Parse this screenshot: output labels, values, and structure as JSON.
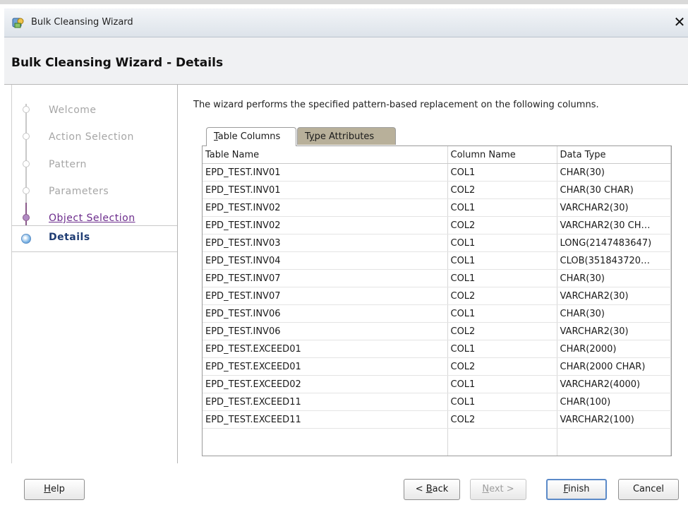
{
  "window": {
    "title": "Bulk Cleansing Wizard",
    "close_glyph": "✕"
  },
  "header": {
    "title": "Bulk Cleansing Wizard - Details"
  },
  "nav": {
    "items": [
      {
        "label": "Welcome",
        "state": "disabled"
      },
      {
        "label": "Action Selection",
        "state": "disabled"
      },
      {
        "label": "Pattern",
        "state": "disabled"
      },
      {
        "label": "Parameters",
        "state": "disabled"
      },
      {
        "label": "Object Selection",
        "state": "visited"
      },
      {
        "label": "Details",
        "state": "current"
      }
    ]
  },
  "main": {
    "description": "The wizard performs the specified pattern-based replacement on the following columns.",
    "tabs": [
      {
        "label": "Table Columns",
        "mnemonic_index": 0,
        "selected": true
      },
      {
        "label": "Type Attributes",
        "mnemonic_index": 1,
        "selected": false
      }
    ],
    "table": {
      "columns": [
        "Table Name",
        "Column Name",
        "Data Type"
      ],
      "rows": [
        [
          "EPD_TEST.INV01",
          "COL1",
          "CHAR(30)"
        ],
        [
          "EPD_TEST.INV01",
          "COL2",
          "CHAR(30 CHAR)"
        ],
        [
          "EPD_TEST.INV02",
          "COL1",
          "VARCHAR2(30)"
        ],
        [
          "EPD_TEST.INV02",
          "COL2",
          "VARCHAR2(30 CH…"
        ],
        [
          "EPD_TEST.INV03",
          "COL1",
          "LONG(2147483647)"
        ],
        [
          "EPD_TEST.INV04",
          "COL1",
          "CLOB(351843720…"
        ],
        [
          "EPD_TEST.INV07",
          "COL1",
          "CHAR(30)"
        ],
        [
          "EPD_TEST.INV07",
          "COL2",
          "VARCHAR2(30)"
        ],
        [
          "EPD_TEST.INV06",
          "COL1",
          "CHAR(30)"
        ],
        [
          "EPD_TEST.INV06",
          "COL2",
          "VARCHAR2(30)"
        ],
        [
          "EPD_TEST.EXCEED01",
          "COL1",
          "CHAR(2000)"
        ],
        [
          "EPD_TEST.EXCEED01",
          "COL2",
          "CHAR(2000 CHAR)"
        ],
        [
          "EPD_TEST.EXCEED02",
          "COL1",
          "VARCHAR2(4000)"
        ],
        [
          "EPD_TEST.EXCEED11",
          "COL1",
          "CHAR(100)"
        ],
        [
          "EPD_TEST.EXCEED11",
          "COL2",
          "VARCHAR2(100)"
        ]
      ]
    }
  },
  "footer": {
    "help": "Help",
    "back": "< Back",
    "next": "Next >",
    "finish": "Finish",
    "cancel": "Cancel"
  },
  "colors": {
    "visited_link": "#6c2c8c",
    "current_step": "#1f3c73",
    "inactive_tab": "#b8b09a"
  }
}
